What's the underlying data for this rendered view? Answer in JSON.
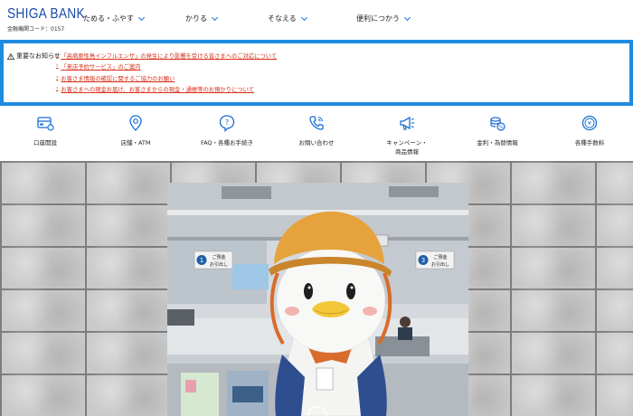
{
  "header": {
    "logo": "SHIGA BANK",
    "bank_code": "金融機関コード：0157",
    "nav": [
      {
        "label": "ためる・ふやす"
      },
      {
        "label": "かりる"
      },
      {
        "label": "そなえる"
      },
      {
        "label": "便利につかう"
      }
    ]
  },
  "notice": {
    "title": "重要なお知らせ",
    "items": [
      "「高病原性鳥インフルエンザ」の発生により影響を受ける皆さまへのご対応について",
      "「来店予約サービス」のご案内",
      "お客さま情報の確認に関するご協力のお願い",
      "お客さまへの現金お届け、お客さまからの現金・通帳等のお預かりについて"
    ]
  },
  "quick_links": [
    {
      "icon": "card-icon",
      "label": "口座開設"
    },
    {
      "icon": "location-pin-icon",
      "label": "店舗・ATM"
    },
    {
      "icon": "question-icon",
      "label": "FAQ・各種お手続き"
    },
    {
      "icon": "phone-icon",
      "label": "お問い合わせ"
    },
    {
      "icon": "megaphone-icon",
      "label": "キャンペーン・",
      "label2": "商品情報"
    },
    {
      "icon": "coins-icon",
      "label": "金利・為替情報"
    },
    {
      "icon": "fee-icon",
      "label": "各種手数料"
    }
  ],
  "hero": {
    "sign_left_num": "1",
    "sign_left_text": "ご預金",
    "sign_left_sub": "お引出し",
    "sign_right_num": "3",
    "sign_right_text": "ご預金",
    "sign_right_sub": "お引出し"
  },
  "colors": {
    "brand_blue": "#1a4aa8",
    "notice_border": "#1d8ce0",
    "notice_link": "#d8301a"
  }
}
